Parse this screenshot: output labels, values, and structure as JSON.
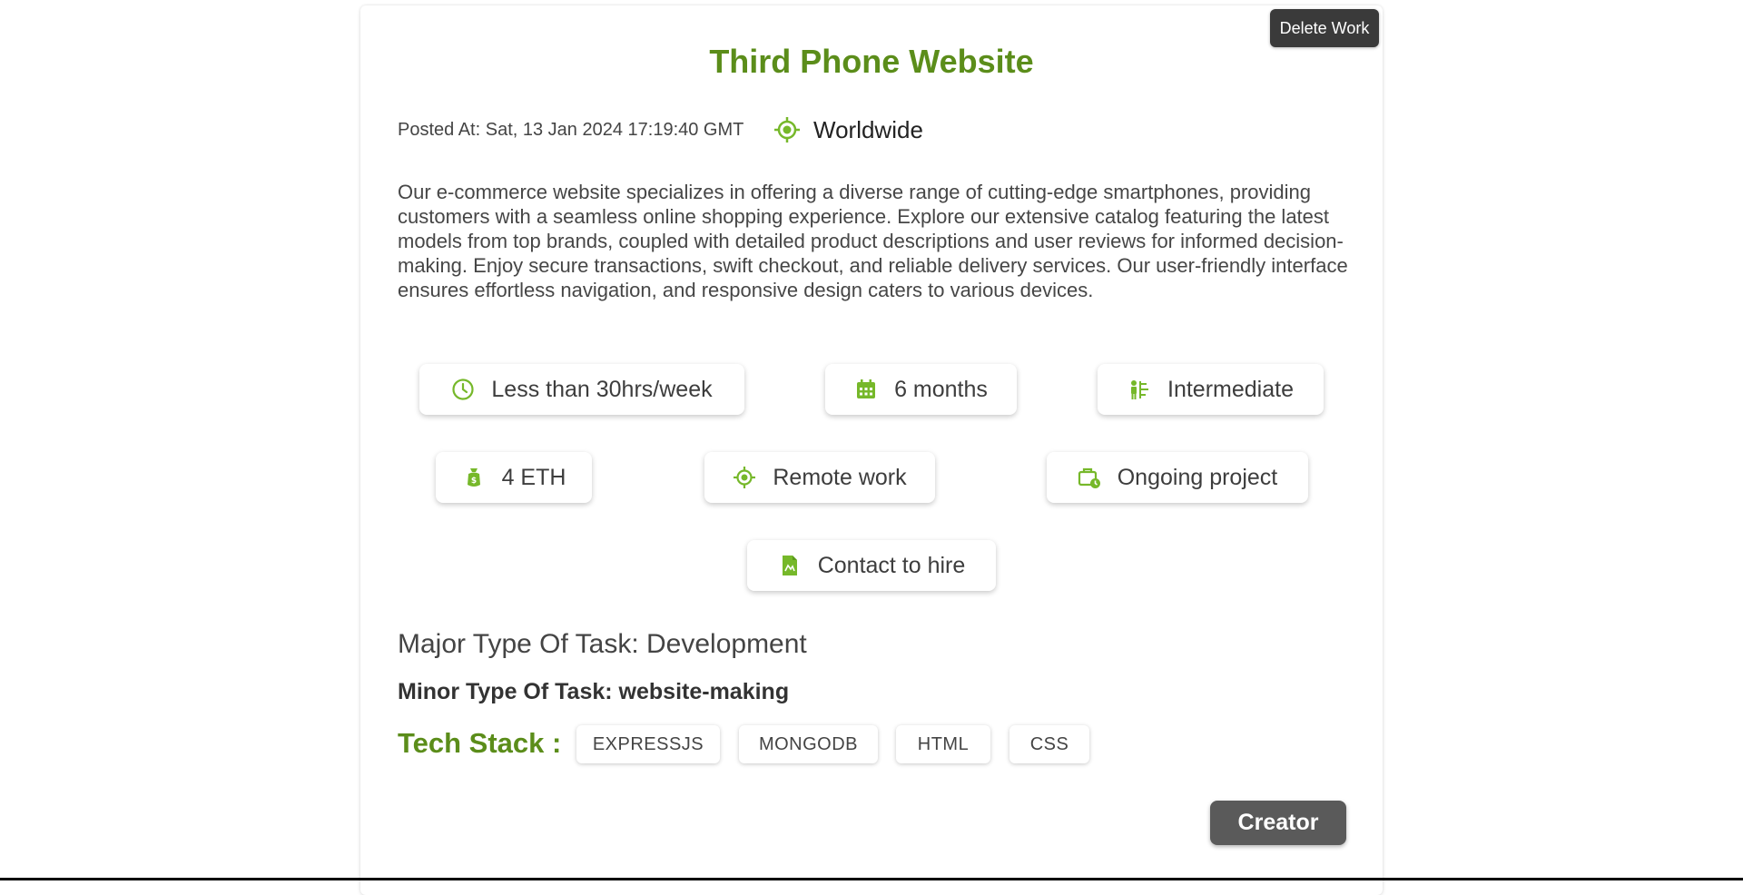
{
  "header": {
    "delete_label": "Delete Work"
  },
  "job": {
    "title": "Third Phone Website",
    "posted_at": "Posted At: Sat, 13 Jan 2024 17:19:40 GMT",
    "location": "Worldwide",
    "description": "Our e-commerce website specializes in offering a diverse range of cutting-edge smartphones, providing customers with a seamless online shopping experience. Explore our extensive catalog featuring the latest models from top brands, coupled with detailed product descriptions and user reviews for informed decision-making. Enjoy secure transactions, swift checkout, and reliable delivery services. Our user-friendly interface ensures effortless navigation, and responsive design caters to various devices."
  },
  "details": [
    {
      "label": "Less than 30hrs/week",
      "icon": "clock-icon"
    },
    {
      "label": "6 months",
      "icon": "calendar-icon"
    },
    {
      "label": "Intermediate",
      "icon": "experience-level-icon"
    },
    {
      "label": "4 ETH",
      "icon": "payment-icon"
    },
    {
      "label": "Remote work",
      "icon": "remote-location-icon"
    },
    {
      "label": "Ongoing project",
      "icon": "briefcase-clock-icon"
    },
    {
      "label": "Contact to hire",
      "icon": "document-icon"
    }
  ],
  "task": {
    "major": "Major Type Of Task: Development",
    "minor": "Minor Type Of Task: website-making"
  },
  "tech_stack": {
    "label": "Tech Stack :",
    "items": [
      "EXPRESSJS",
      "MONGODB",
      "HTML",
      "CSS"
    ]
  },
  "footer": {
    "creator_label": "Creator"
  },
  "colors": {
    "accent_green": "#5b8d1a",
    "icon_green": "#76b82a",
    "delete_button_bg": "#3a3a3a",
    "creator_button_bg": "#5a5a5a"
  }
}
